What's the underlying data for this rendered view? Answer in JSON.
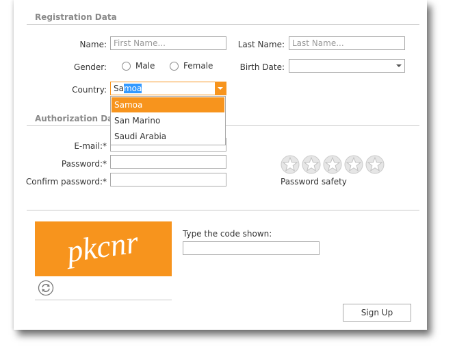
{
  "registration": {
    "title": "Registration Data",
    "name_label": "Name:",
    "name_placeholder": "First Name...",
    "lastname_label": "Last Name:",
    "lastname_placeholder": "Last Name...",
    "gender_label": "Gender:",
    "gender_male": "Male",
    "gender_female": "Female",
    "birthdate_label": "Birth Date:",
    "country_label": "Country:",
    "country_typed": "Sa",
    "country_autocomplete": "moa",
    "country_options": [
      "Samoa",
      "San Marino",
      "Saudi Arabia"
    ]
  },
  "authorization": {
    "title": "Authorization Data",
    "email_label": "E-mail:*",
    "password_label": "Password:*",
    "confirm_label": "Confirm password:*",
    "password_safety_label": "Password safety",
    "password_safety_rating": 0,
    "password_safety_max": 5
  },
  "captcha": {
    "code_text": "pkcnr",
    "prompt": "Type the code shown:"
  },
  "actions": {
    "signup_label": "Sign Up"
  },
  "colors": {
    "accent": "#f7941d",
    "text_selection": "#3399ff"
  }
}
